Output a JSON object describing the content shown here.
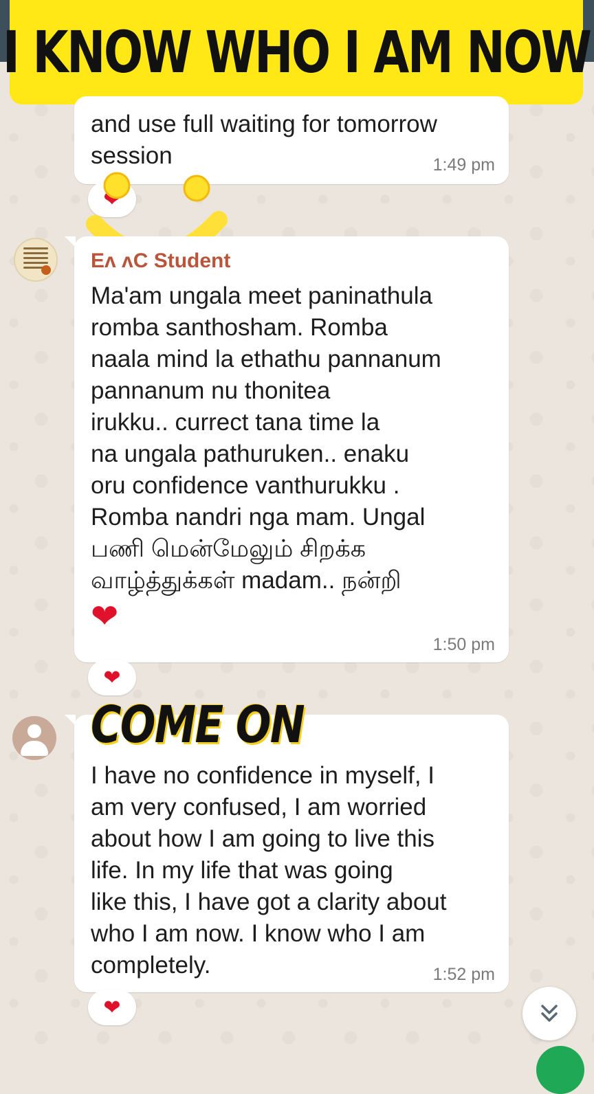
{
  "banner": {
    "title": "I KNOW WHO I AM NOW"
  },
  "messages": [
    {
      "text": "and use full  waiting for tomorrow\nsession",
      "time": "1:49 pm",
      "reaction": "❤"
    },
    {
      "sender": "Eᴧ        ᴧC Student",
      "text": "Ma'am ungala meet paninathula\nromba santhosham. Romba\nnaala mind la ethathu pannanum\npannanum nu thonitea\nirukku.. currect tana time la\nna ungala pathuruken.. enaku\noru confidence vanthurukku .\nRomba nandri  nga mam. Ungal\nபணி மென்மேலும் சிறக்க\nவாழ்த்துக்கள் madam.. நன்றி",
      "inline_emoji": "❤",
      "time": "1:50 pm",
      "reaction": "❤"
    },
    {
      "sender": "",
      "text": "I have no confidence in myself, I\nam very confused, I am worried\nabout how I am going to live this\nlife.  In my life that was going\nlike this, I have got a clarity about\nwho I am now.  I know who I am\ncompletely.",
      "time": "1:52 pm",
      "reaction": "❤"
    }
  ],
  "overlay": {
    "come_on": "COME ON"
  },
  "icons": {
    "scroll_down": "double-chevron-down-icon",
    "smiley": "smiley-face-icon"
  },
  "colors": {
    "banner": "#ffe815",
    "sender": "#b9553a",
    "heart": "#e0112a"
  }
}
